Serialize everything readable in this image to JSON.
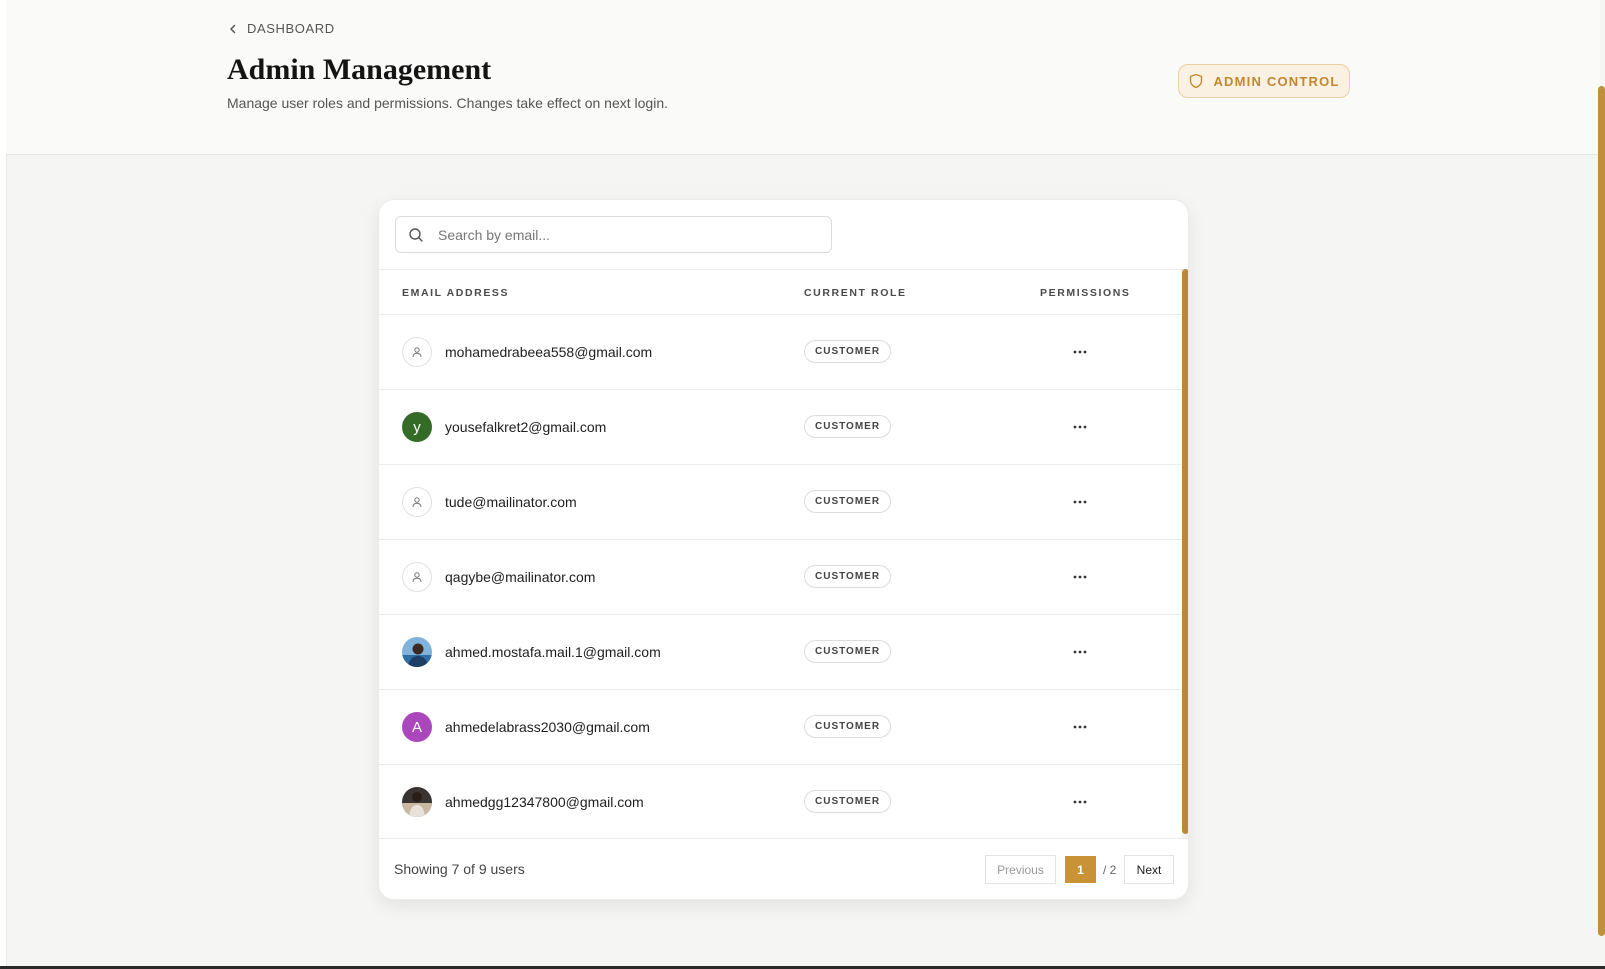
{
  "header": {
    "back_label": "DASHBOARD",
    "title": "Admin Management",
    "subtitle": "Manage user roles and permissions. Changes take effect on next login.",
    "badge_label": "ADMIN CONTROL"
  },
  "search": {
    "placeholder": "Search by email...",
    "value": ""
  },
  "table": {
    "columns": [
      "EMAIL ADDRESS",
      "CURRENT ROLE",
      "PERMISSIONS"
    ],
    "rows": [
      {
        "email": "mohamedrabeea558@gmail.com",
        "role": "CUSTOMER",
        "avatar": "default-user-icon"
      },
      {
        "email": "yousefalkret2@gmail.com",
        "role": "CUSTOMER",
        "avatar_letter": "y",
        "avatar_color": "#346b27"
      },
      {
        "email": "tude@mailinator.com",
        "role": "CUSTOMER",
        "avatar": "default-user-icon"
      },
      {
        "email": "qagybe@mailinator.com",
        "role": "CUSTOMER",
        "avatar": "default-user-icon"
      },
      {
        "email": "ahmed.mostafa.mail.1@gmail.com",
        "role": "CUSTOMER",
        "avatar": "photo"
      },
      {
        "email": "ahmedelabrass2030@gmail.com",
        "role": "CUSTOMER",
        "avatar_letter": "A",
        "avatar_color": "#ab47bc"
      },
      {
        "email": "ahmedgg12347800@gmail.com",
        "role": "CUSTOMER",
        "avatar": "photo"
      }
    ]
  },
  "footer": {
    "showing": "Showing 7 of 9 users",
    "previous_label": "Previous",
    "current_page": "1",
    "total_pages": "/ 2",
    "next_label": "Next"
  },
  "colors": {
    "accent": "#c99236",
    "badge_bg": "#fbf1e2",
    "badge_text": "#c0882f"
  },
  "icons": {
    "back": "chevron-left-icon",
    "badge": "shield-icon",
    "search": "search-icon",
    "row_action": "more-horizontal-icon"
  }
}
